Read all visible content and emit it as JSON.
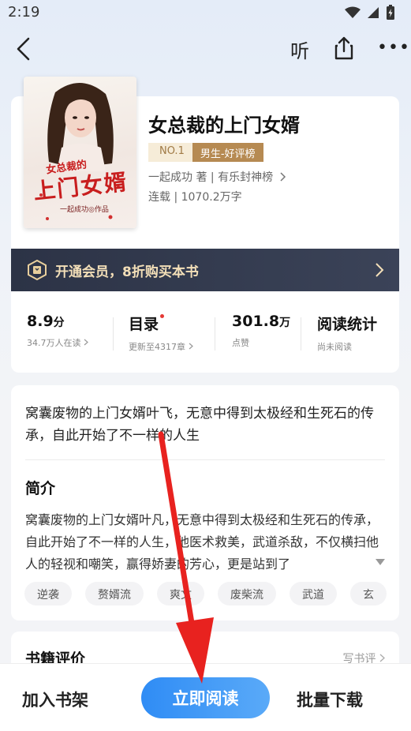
{
  "status_bar": {
    "time": "2:19"
  },
  "nav": {
    "listen_label": "听"
  },
  "book": {
    "title": "女总裁的上门女婿",
    "cover": {
      "subtitle": "女总裁的",
      "title": "上门女婿",
      "author": "一起成功◎作品"
    },
    "rank_no": "NO.1",
    "rank_name": "男生-好评榜",
    "meta_author": "一起成功 著 | 有乐封神榜",
    "meta_status": "连载 | 1070.2万字"
  },
  "vip": {
    "text": "开通会员，8折购买本书"
  },
  "stats": [
    {
      "value": "8.9",
      "unit": "分",
      "sub": "34.7万人在读"
    },
    {
      "value": "目录",
      "unit": "",
      "sub": "更新至4317章"
    },
    {
      "value": "301.8",
      "unit": "万",
      "sub": "点赞"
    },
    {
      "value": "阅读统计",
      "unit": "",
      "sub": "尚未阅读"
    }
  ],
  "description": {
    "short": "窝囊废物的上门女婿叶飞，无意中得到太极经和生死石的传承，自此开始了不一样的人生",
    "intro_heading": "简介",
    "intro_text": "窝囊废物的上门女婿叶凡，无意中得到太极经和生死石的传承，自此开始了不一样的人生，他医术救美，武道杀敌，不仅横扫他人的轻视和嘲笑，赢得娇妻的芳心，更是站到了",
    "tags": [
      "逆袭",
      "赘婿流",
      "爽文",
      "废柴流",
      "武道",
      "玄"
    ]
  },
  "review": {
    "heading": "书籍评价",
    "write_label": "写书评"
  },
  "bottom": {
    "shelf_label": "加入书架",
    "read_label": "立即阅读",
    "download_label": "批量下载"
  },
  "colors": {
    "primary_blue": "#2f8cf5",
    "vip_gold": "#f3dfb8",
    "rank_gold": "#b68a52",
    "annotation_red": "#e8221f"
  }
}
